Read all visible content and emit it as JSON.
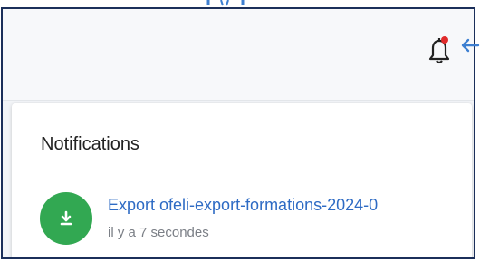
{
  "header": {
    "bell_icon": "bell-icon",
    "has_unread": true,
    "accent_color": "#e02b2b"
  },
  "panel": {
    "title": "Notifications",
    "items": [
      {
        "icon": "download-icon",
        "icon_color": "#32a852",
        "title": "Export ofeli-export-formations-2024-0",
        "time": "il y a 7 secondes",
        "title_color": "#2e6bc4"
      }
    ]
  },
  "annotation": {
    "arrow_icon": "arrow-left-icon",
    "arrow_color": "#3d7fd1",
    "frame_color": "#1b2f5a"
  }
}
